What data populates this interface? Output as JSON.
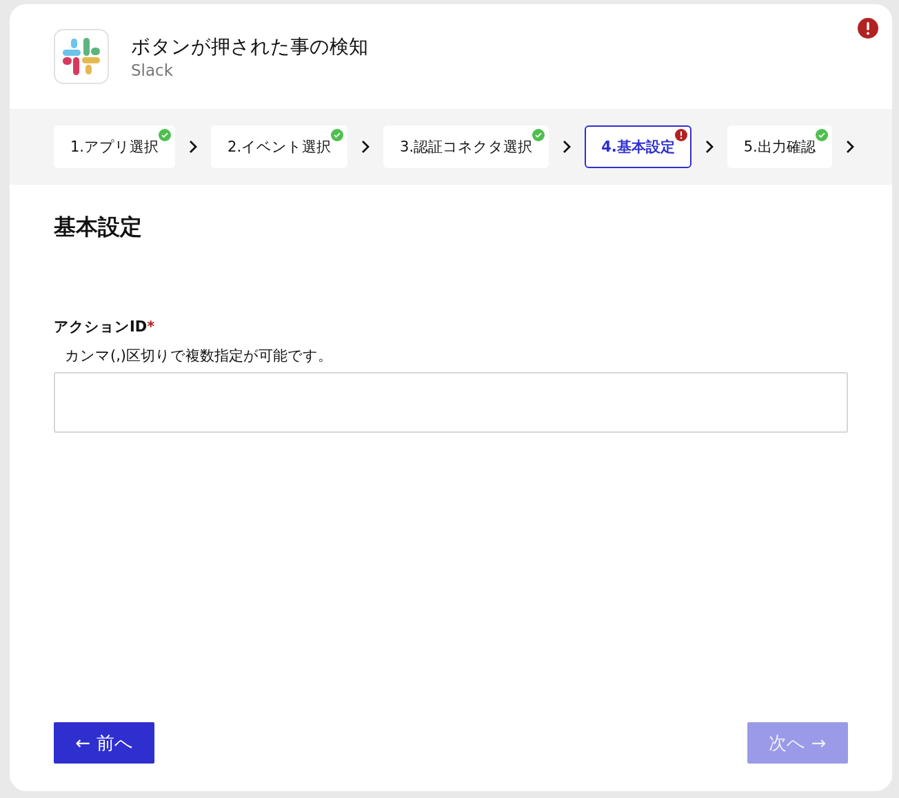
{
  "header": {
    "title": "ボタンが押された事の検知",
    "app_name": "Slack",
    "alert": true
  },
  "steps": [
    {
      "label": "1.アプリ選択",
      "kind": "done",
      "selected": false
    },
    {
      "label": "2.イベント選択",
      "kind": "done",
      "selected": false
    },
    {
      "label": "3.認証コネクタ選択",
      "kind": "done",
      "selected": false
    },
    {
      "label": "4.基本設定",
      "kind": "error",
      "selected": true
    },
    {
      "label": "5.出力確認",
      "kind": "done",
      "selected": false
    }
  ],
  "section_title": "基本設定",
  "field": {
    "label": "アクションID",
    "required_mark": "*",
    "hint": "カンマ(,)区切りで複数指定が可能です。"
  },
  "buttons": [
    {
      "label": "← 前へ",
      "disabled": false
    },
    {
      "label": "次へ →",
      "disabled": true
    }
  ]
}
